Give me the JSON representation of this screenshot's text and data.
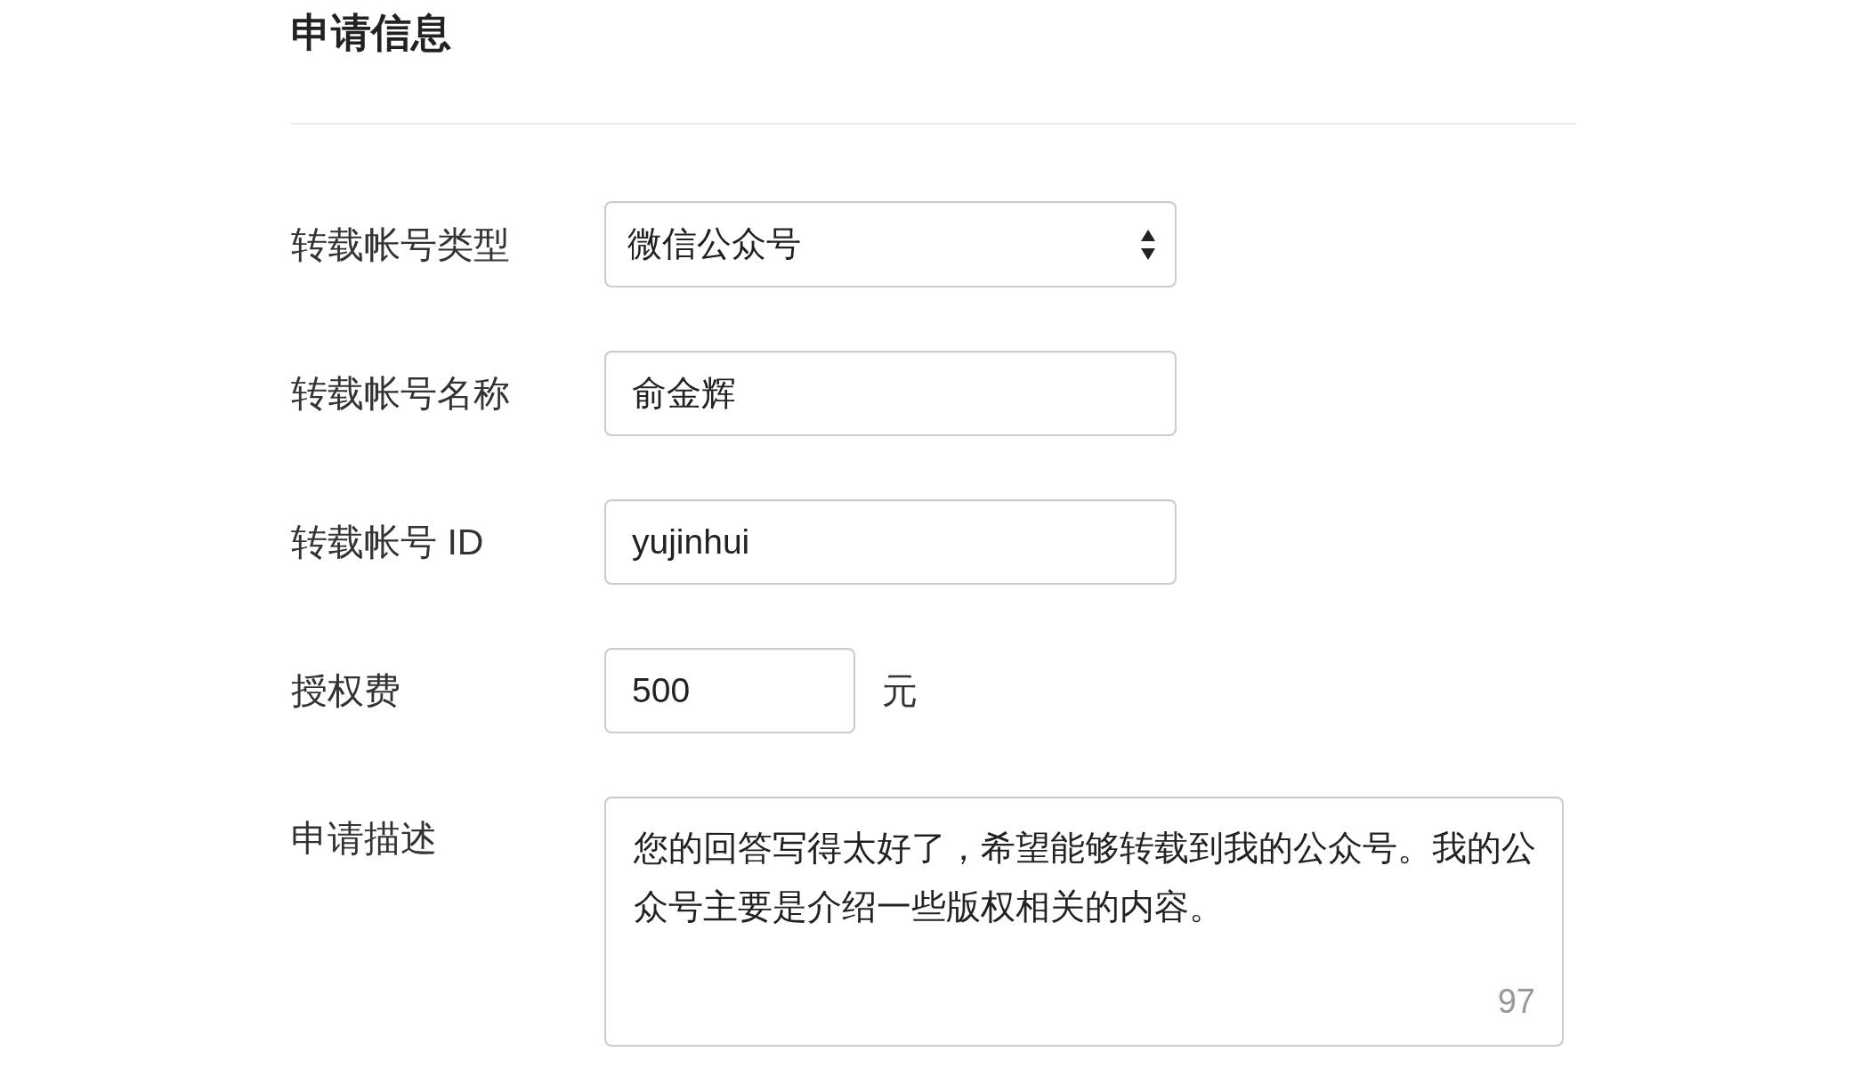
{
  "title": "申请信息",
  "fields": [
    {
      "kind": "select",
      "label": "转载帐号类型",
      "value": "微信公众号"
    },
    {
      "kind": "text",
      "label": "转载帐号名称",
      "value": "俞金辉"
    },
    {
      "kind": "text",
      "label": "转载帐号 ID",
      "value": "yujinhui"
    },
    {
      "kind": "amount",
      "label": "授权费",
      "value": "500",
      "unit": "元"
    },
    {
      "kind": "textarea",
      "label": "申请描述",
      "value": "您的回答写得太好了，希望能够转载到我的公众号。我的公众号主要是介绍一些版权相关的内容。",
      "counter": "97"
    }
  ]
}
